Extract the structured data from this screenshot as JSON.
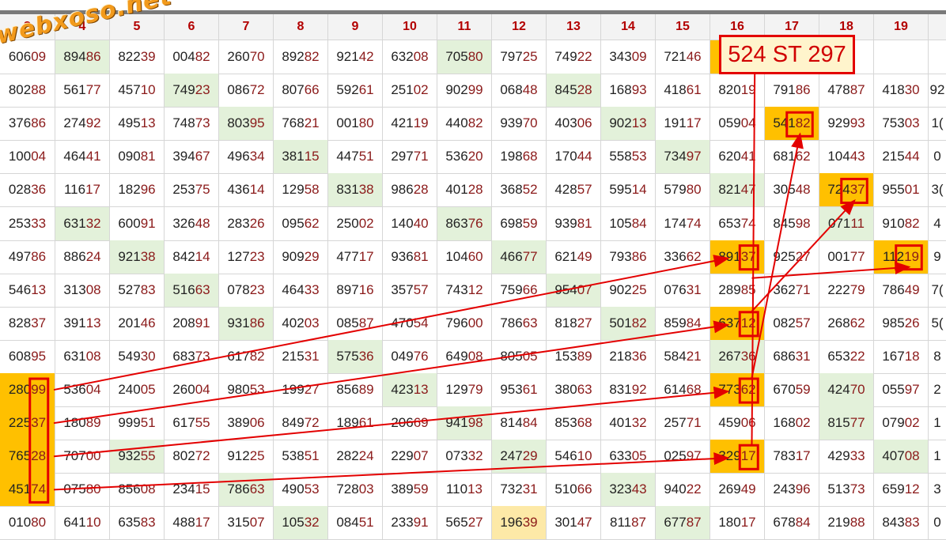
{
  "watermark": "webxoso.net",
  "result_label": "524 ST 297",
  "columns": [
    "3",
    "4",
    "5",
    "6",
    "7",
    "8",
    "9",
    "10",
    "11",
    "12",
    "13",
    "14",
    "15",
    "16",
    "17",
    "18",
    "19",
    ""
  ],
  "rows": [
    [
      "60609",
      "89486",
      "82239",
      "00482",
      "26070",
      "89282",
      "92142",
      "63208",
      "70580",
      "79725",
      "74922",
      "34309",
      "72146",
      "",
      "",
      "",
      "",
      ""
    ],
    [
      "80288",
      "56177",
      "45710",
      "74923",
      "08672",
      "80766",
      "59261",
      "25102",
      "90299",
      "06848",
      "84528",
      "16893",
      "41861",
      "82019",
      "79186",
      "47887",
      "41830",
      "92"
    ],
    [
      "37686",
      "27492",
      "49513",
      "74873",
      "80395",
      "76821",
      "00180",
      "42119",
      "44082",
      "93970",
      "40306",
      "90213",
      "19117",
      "05904",
      "54182",
      "92993",
      "75303",
      "1("
    ],
    [
      "10004",
      "46441",
      "09081",
      "39467",
      "49634",
      "38115",
      "44751",
      "29771",
      "53620",
      "19868",
      "17044",
      "55853",
      "73497",
      "62041",
      "68162",
      "10443",
      "21544",
      "0"
    ],
    [
      "02836",
      "11617",
      "18296",
      "25375",
      "43614",
      "12958",
      "83138",
      "98628",
      "40128",
      "36852",
      "42857",
      "59514",
      "57980",
      "82147",
      "30548",
      "72437",
      "95501",
      "3("
    ],
    [
      "25333",
      "63132",
      "60091",
      "32648",
      "28326",
      "09562",
      "25002",
      "14040",
      "86376",
      "69859",
      "93981",
      "10584",
      "17474",
      "65374",
      "84598",
      "07111",
      "91082",
      "4"
    ],
    [
      "49786",
      "88624",
      "92138",
      "84214",
      "12723",
      "90929",
      "47717",
      "93681",
      "10460",
      "46677",
      "62149",
      "79386",
      "33662",
      "89137",
      "92527",
      "00177",
      "11219",
      "9"
    ],
    [
      "54613",
      "31308",
      "52783",
      "51663",
      "07823",
      "46433",
      "89716",
      "35757",
      "74312",
      "75966",
      "95407",
      "90225",
      "07631",
      "28985",
      "36271",
      "22279",
      "78649",
      "7("
    ],
    [
      "82837",
      "39113",
      "20146",
      "20891",
      "93186",
      "40203",
      "08587",
      "47054",
      "79600",
      "78663",
      "81827",
      "50182",
      "85984",
      "63712",
      "08257",
      "26862",
      "98526",
      "5("
    ],
    [
      "60895",
      "63108",
      "54930",
      "68373",
      "61782",
      "21531",
      "57536",
      "04976",
      "64908",
      "80505",
      "15389",
      "21836",
      "58421",
      "26736",
      "68631",
      "65322",
      "16718",
      "8"
    ],
    [
      "28099",
      "53604",
      "24005",
      "26004",
      "98053",
      "19927",
      "85689",
      "42313",
      "12979",
      "95361",
      "38063",
      "83192",
      "61468",
      "77362",
      "67059",
      "42470",
      "05597",
      "2"
    ],
    [
      "22537",
      "18089",
      "99951",
      "61755",
      "38906",
      "84972",
      "18961",
      "20669",
      "94198",
      "81484",
      "85368",
      "40132",
      "25771",
      "45906",
      "16802",
      "81577",
      "07902",
      "1"
    ],
    [
      "76528",
      "70700",
      "93255",
      "80272",
      "91225",
      "53851",
      "28224",
      "22907",
      "07332",
      "24729",
      "54610",
      "63305",
      "02597",
      "32917",
      "78317",
      "42933",
      "40708",
      "1"
    ],
    [
      "45174",
      "07580",
      "85608",
      "23415",
      "78663",
      "49053",
      "72803",
      "38959",
      "11013",
      "73231",
      "51066",
      "32343",
      "94022",
      "26949",
      "24396",
      "51373",
      "65912",
      "3"
    ],
    [
      "01080",
      "64110",
      "63583",
      "48817",
      "31507",
      "10532",
      "08451",
      "23391",
      "56527",
      "19639",
      "30147",
      "81187",
      "67787",
      "18017",
      "67884",
      "21988",
      "84383",
      "0"
    ]
  ],
  "highlights_green": [
    "0-1",
    "0-8",
    "0-13",
    "1-3",
    "1-10",
    "2-4",
    "2-11",
    "3-5",
    "3-12",
    "4-6",
    "4-13",
    "5-1",
    "5-8",
    "5-15",
    "6-2",
    "6-9",
    "7-3",
    "7-10",
    "8-4",
    "8-11",
    "9-6",
    "9-13",
    "10-7",
    "10-15",
    "11-8",
    "11-15",
    "12-2",
    "12-9",
    "12-16",
    "13-4",
    "13-11",
    "14-5",
    "14-12"
  ],
  "highlights_orange": [
    "0-13",
    "2-14",
    "4-15",
    "6-13",
    "6-16",
    "8-13",
    "10-0",
    "10-13",
    "11-0",
    "12-0",
    "12-13",
    "13-0"
  ],
  "highlights_yellow": [
    "14-9"
  ],
  "markers": [
    {
      "name": "marker-pair-col3",
      "row": 10,
      "col": 0,
      "rows": 4,
      "d": 2
    },
    {
      "name": "marker-54182",
      "row": 2,
      "col": 14,
      "rows": 1,
      "d": 3
    },
    {
      "name": "marker-72437",
      "row": 4,
      "col": 15,
      "rows": 1,
      "d": 3
    },
    {
      "name": "marker-89137",
      "row": 6,
      "col": 13,
      "rows": 1,
      "d": 2
    },
    {
      "name": "marker-11219",
      "row": 6,
      "col": 16,
      "rows": 1,
      "d": 3
    },
    {
      "name": "marker-63712",
      "row": 8,
      "col": 13,
      "rows": 1,
      "d": 2
    },
    {
      "name": "marker-77362",
      "row": 10,
      "col": 13,
      "rows": 1,
      "d": 2
    },
    {
      "name": "marker-32917",
      "row": 12,
      "col": 13,
      "rows": 1,
      "d": 2
    }
  ],
  "arrows": [
    {
      "name": "arrow-r10-to-r6",
      "from": [
        10,
        0
      ],
      "to": [
        6,
        13
      ]
    },
    {
      "name": "arrow-r11-to-r8",
      "from": [
        11,
        0
      ],
      "to": [
        8,
        13
      ]
    },
    {
      "name": "arrow-r12-to-r10",
      "from": [
        12,
        0
      ],
      "to": [
        10,
        13
      ]
    },
    {
      "name": "arrow-r13-to-r12",
      "from": [
        13,
        0
      ],
      "to": [
        12,
        13
      ]
    },
    {
      "name": "arrow-r7-to-r6c16",
      "from": [
        7,
        13
      ],
      "to": [
        6,
        16
      ]
    },
    {
      "name": "arrow-r10-to-r2",
      "from": [
        10,
        13
      ],
      "to": [
        2,
        14
      ]
    },
    {
      "name": "arrow-r8-to-r4",
      "from": [
        8,
        13
      ],
      "to": [
        4,
        15
      ]
    },
    {
      "name": "arrow-r12-to-result",
      "from": [
        12,
        13
      ],
      "to": [
        -1,
        13
      ]
    }
  ],
  "colors": {
    "green": "#e3f1da",
    "orange": "#ffc000",
    "yellow": "#fde9a7",
    "red": "#e30000"
  }
}
